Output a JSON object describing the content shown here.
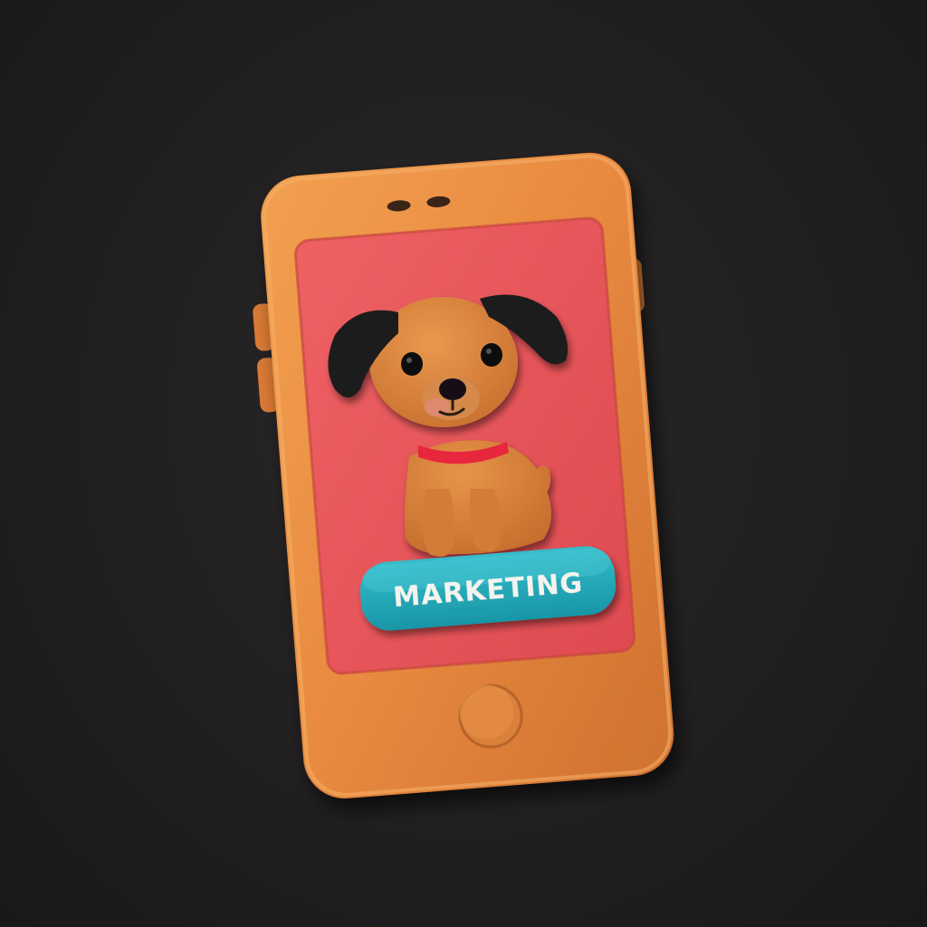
{
  "scene": {
    "subject": "clay-phone",
    "badge": {
      "label": "MARKETING"
    }
  },
  "colors": {
    "background": "#211f20",
    "phone_body": "#e8893f",
    "phone_screen": "#e8565a",
    "dog_fur": "#d9833e",
    "dog_ears": "#1f1b1c",
    "collar": "#e8283d",
    "badge_fill": "#1fa9b8",
    "badge_text": "#f4f4ee"
  },
  "icons": [
    "speaker-slots-icon",
    "home-button-icon",
    "puppy-figure-icon"
  ]
}
